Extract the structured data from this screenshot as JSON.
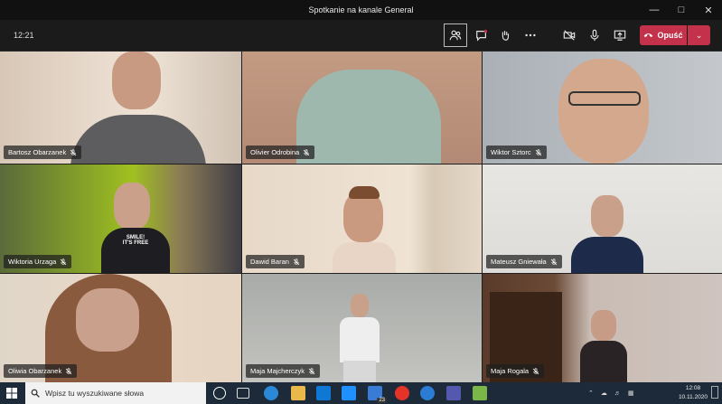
{
  "window": {
    "title": "Spotkanie na kanale General"
  },
  "meeting": {
    "timer": "12:21",
    "leave_label": "Opuść"
  },
  "participants": [
    {
      "name": "Bartosz Obarzanek"
    },
    {
      "name": "Olivier Odrobina"
    },
    {
      "name": "Wiktor Sztorc"
    },
    {
      "name": "Wiktoria Urzaga"
    },
    {
      "name": "Dawid Baran"
    },
    {
      "name": "Mateusz Gniewała"
    },
    {
      "name": "Oliwia Obarzanek"
    },
    {
      "name": "Maja Majcherczyk"
    },
    {
      "name": "Maja Rogala"
    }
  ],
  "shirt_text": {
    "line1": "SMILE!",
    "line2": "IT'S FREE"
  },
  "taskbar": {
    "search_placeholder": "Wpisz tu wyszukiwane słowa",
    "badge": "23",
    "time": "12:08",
    "date": "10.11.2020"
  },
  "colors": {
    "leave": "#c4314b",
    "taskbar": "#1c2a3a"
  }
}
